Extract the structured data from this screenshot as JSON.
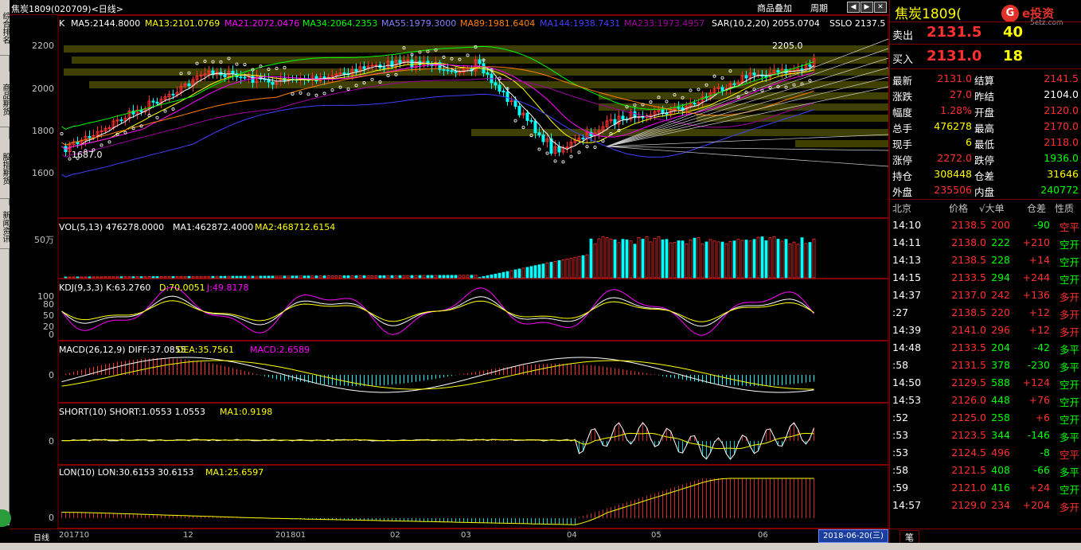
{
  "window": {
    "title": "焦炭1809(020709)<日线>",
    "buttons": [
      "商品叠加",
      "周期"
    ]
  },
  "left_tabs": [
    "综合排名",
    "商品期货",
    "股指期货",
    "新闻资讯"
  ],
  "main_chart": {
    "indicator_line": "K",
    "ma": [
      {
        "label": "MA5:2144.8000",
        "color": "#ffffff"
      },
      {
        "label": "MA13:2101.0769",
        "color": "#ffff00"
      },
      {
        "label": "MA21:2072.0476",
        "color": "#ff00ff"
      },
      {
        "label": "MA34:2064.2353",
        "color": "#00ff00"
      },
      {
        "label": "MA55:1979.3000",
        "color": "#8080ff"
      },
      {
        "label": "MA89:1981.6404",
        "color": "#ff8000"
      },
      {
        "label": "MA144:1938.7431",
        "color": "#4040ff"
      },
      {
        "label": "MA233:1973.4957",
        "color": "#a000a0"
      }
    ],
    "sar_label": "SAR(10,2,20) 2055.0704",
    "sslo_label": "SSLO 2137.5",
    "y_ticks": [
      "2200",
      "2000",
      "1800",
      "1600"
    ],
    "high_label": "2205.0",
    "low_label": "1687.0"
  },
  "vol_panel": {
    "label": "VOL(5,13) 476278.0000",
    "ma1": "MA1:462872.4000",
    "ma2": "MA2:468712.6154",
    "y_tick": "50万"
  },
  "kdj_panel": {
    "label": "KDJ(9,3,3) K:63.2760",
    "d": "D:70.0051",
    "j": "J:49.8178",
    "y_ticks": [
      "100",
      "80",
      "50",
      "20",
      "0"
    ]
  },
  "macd_panel": {
    "label": "MACD(26,12,9) DIFF:37.0855",
    "dea": "DEA:35.7561",
    "macd": "MACD:2.6589",
    "y_tick": "0"
  },
  "short_panel": {
    "label": "SHORT(10) SHORT:1.0553 1.0553",
    "ma1": "MA1:0.9198",
    "y_tick": "0"
  },
  "lon_panel": {
    "label": "LON(10) LON:30.6153 30.6153",
    "ma1": "MA1:25.6597",
    "y_tick": "0"
  },
  "x_axis": {
    "period": "日线",
    "labels": [
      "201710",
      "12",
      "201801",
      "02",
      "03",
      "04",
      "05",
      "06"
    ],
    "current_date": "2018-06-20(三)"
  },
  "right_panel": {
    "name": "焦炭1809(",
    "logo_text": "e投资",
    "logo_sub": "5etz.com",
    "sell": {
      "label": "卖出",
      "price": "2131.5",
      "vol": "40"
    },
    "buy": {
      "label": "买入",
      "price": "2131.0",
      "vol": "18"
    },
    "quotes": [
      {
        "l1": "最新",
        "v1": "2131.0",
        "c1": "#ff3030",
        "l2": "结算",
        "v2": "2141.5",
        "c2": "#ff3030"
      },
      {
        "l1": "涨跌",
        "v1": "27.0",
        "c1": "#ff3030",
        "l2": "昨结",
        "v2": "2104.0",
        "c2": "#ffffff"
      },
      {
        "l1": "幅度",
        "v1": "1.28%",
        "c1": "#ff3030",
        "l2": "开盘",
        "v2": "2120.0",
        "c2": "#ff3030"
      },
      {
        "l1": "总手",
        "v1": "476278",
        "c1": "#ffff00",
        "l2": "最高",
        "v2": "2170.0",
        "c2": "#ff3030"
      },
      {
        "l1": "现手",
        "v1": "6",
        "c1": "#ffff00",
        "l2": "最低",
        "v2": "2118.0",
        "c2": "#ff3030"
      },
      {
        "l1": "涨停",
        "v1": "2272.0",
        "c1": "#ff3030",
        "l2": "跌停",
        "v2": "1936.0",
        "c2": "#00ff00"
      },
      {
        "l1": "持仓",
        "v1": "308448",
        "c1": "#ffff00",
        "l2": "仓差",
        "v2": "31646",
        "c2": "#ffff00"
      },
      {
        "l1": "外盘",
        "v1": "235506",
        "c1": "#ff3030",
        "l2": "内盘",
        "v2": "240772",
        "c2": "#00ff00"
      }
    ],
    "tick_header": {
      "time": "北京",
      "price": "价格",
      "vol": "√大单",
      "oi": "仓差",
      "nature": "性质"
    },
    "ticks": [
      {
        "time": "14:10",
        "price": "2138.5",
        "pc": "#ff3030",
        "vol": "200",
        "vc": "#ff3030",
        "oi": "-90",
        "nature": "空平",
        "nc": "#ff3030"
      },
      {
        "time": "14:11",
        "price": "2138.0",
        "pc": "#ff3030",
        "vol": "222",
        "vc": "#00ff00",
        "oi": "+210",
        "nature": "空开",
        "nc": "#00ff00"
      },
      {
        "time": "14:13",
        "price": "2138.5",
        "pc": "#ff3030",
        "vol": "228",
        "vc": "#00ff00",
        "oi": "+14",
        "nature": "空开",
        "nc": "#00ff00"
      },
      {
        "time": "14:15",
        "price": "2133.5",
        "pc": "#ff3030",
        "vol": "294",
        "vc": "#00ff00",
        "oi": "+244",
        "nature": "空开",
        "nc": "#00ff00"
      },
      {
        "time": "14:37",
        "price": "2137.0",
        "pc": "#ff3030",
        "vol": "242",
        "vc": "#ff3030",
        "oi": "+136",
        "nature": "多开",
        "nc": "#ff3030"
      },
      {
        "time": ":27",
        "price": "2138.5",
        "pc": "#ff3030",
        "vol": "220",
        "vc": "#ff3030",
        "oi": "+12",
        "nature": "多开",
        "nc": "#ff3030"
      },
      {
        "time": "14:39",
        "price": "2141.0",
        "pc": "#ff3030",
        "vol": "296",
        "vc": "#ff3030",
        "oi": "+12",
        "nature": "多开",
        "nc": "#ff3030"
      },
      {
        "time": "14:48",
        "price": "2133.5",
        "pc": "#ff3030",
        "vol": "204",
        "vc": "#00ff00",
        "oi": "-42",
        "nature": "多平",
        "nc": "#00ff00"
      },
      {
        "time": ":58",
        "price": "2131.5",
        "pc": "#ff3030",
        "vol": "378",
        "vc": "#00ff00",
        "oi": "-230",
        "nature": "多平",
        "nc": "#00ff00"
      },
      {
        "time": "14:50",
        "price": "2129.5",
        "pc": "#ff3030",
        "vol": "588",
        "vc": "#00ff00",
        "oi": "+124",
        "nature": "空开",
        "nc": "#00ff00"
      },
      {
        "time": "14:53",
        "price": "2126.0",
        "pc": "#ff3030",
        "vol": "448",
        "vc": "#00ff00",
        "oi": "+76",
        "nature": "空开",
        "nc": "#00ff00"
      },
      {
        "time": ":52",
        "price": "2125.0",
        "pc": "#ff3030",
        "vol": "258",
        "vc": "#00ff00",
        "oi": "+6",
        "nature": "空开",
        "nc": "#00ff00"
      },
      {
        "time": ":53",
        "price": "2123.5",
        "pc": "#ff3030",
        "vol": "344",
        "vc": "#00ff00",
        "oi": "-146",
        "nature": "多平",
        "nc": "#00ff00"
      },
      {
        "time": ":53",
        "price": "2124.5",
        "pc": "#ff3030",
        "vol": "496",
        "vc": "#ff3030",
        "oi": "-8",
        "nature": "空平",
        "nc": "#ff3030"
      },
      {
        "time": ":58",
        "price": "2121.5",
        "pc": "#ff3030",
        "vol": "408",
        "vc": "#00ff00",
        "oi": "-66",
        "nature": "多平",
        "nc": "#00ff00"
      },
      {
        "time": ":59",
        "price": "2121.0",
        "pc": "#ff3030",
        "vol": "416",
        "vc": "#00ff00",
        "oi": "+24",
        "nature": "空开",
        "nc": "#00ff00"
      },
      {
        "time": "14:57",
        "price": "2129.0",
        "pc": "#ff3030",
        "vol": "234",
        "vc": "#ff3030",
        "oi": "+204",
        "nature": "多开",
        "nc": "#ff3030"
      }
    ],
    "bottom_tab": "笔"
  }
}
